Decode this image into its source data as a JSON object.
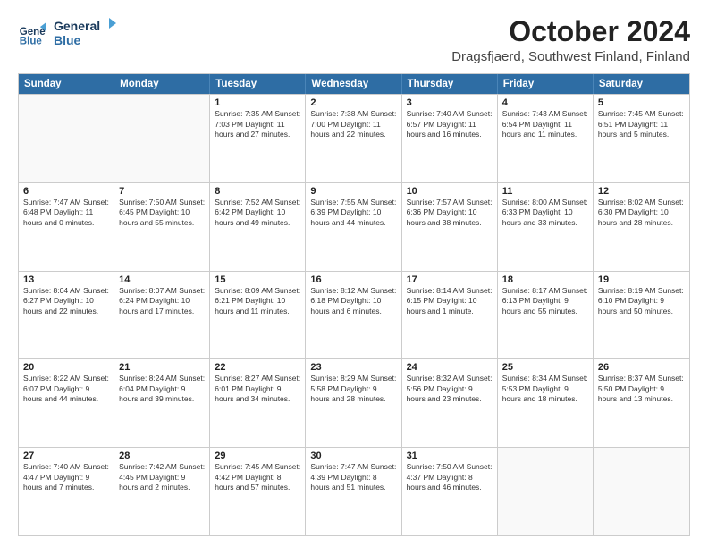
{
  "logo": {
    "line1": "General",
    "line2": "Blue"
  },
  "title": "October 2024",
  "location": "Dragsfjaerd, Southwest Finland, Finland",
  "headers": [
    "Sunday",
    "Monday",
    "Tuesday",
    "Wednesday",
    "Thursday",
    "Friday",
    "Saturday"
  ],
  "weeks": [
    [
      {
        "day": "",
        "info": ""
      },
      {
        "day": "",
        "info": ""
      },
      {
        "day": "1",
        "info": "Sunrise: 7:35 AM\nSunset: 7:03 PM\nDaylight: 11 hours\nand 27 minutes."
      },
      {
        "day": "2",
        "info": "Sunrise: 7:38 AM\nSunset: 7:00 PM\nDaylight: 11 hours\nand 22 minutes."
      },
      {
        "day": "3",
        "info": "Sunrise: 7:40 AM\nSunset: 6:57 PM\nDaylight: 11 hours\nand 16 minutes."
      },
      {
        "day": "4",
        "info": "Sunrise: 7:43 AM\nSunset: 6:54 PM\nDaylight: 11 hours\nand 11 minutes."
      },
      {
        "day": "5",
        "info": "Sunrise: 7:45 AM\nSunset: 6:51 PM\nDaylight: 11 hours\nand 5 minutes."
      }
    ],
    [
      {
        "day": "6",
        "info": "Sunrise: 7:47 AM\nSunset: 6:48 PM\nDaylight: 11 hours\nand 0 minutes."
      },
      {
        "day": "7",
        "info": "Sunrise: 7:50 AM\nSunset: 6:45 PM\nDaylight: 10 hours\nand 55 minutes."
      },
      {
        "day": "8",
        "info": "Sunrise: 7:52 AM\nSunset: 6:42 PM\nDaylight: 10 hours\nand 49 minutes."
      },
      {
        "day": "9",
        "info": "Sunrise: 7:55 AM\nSunset: 6:39 PM\nDaylight: 10 hours\nand 44 minutes."
      },
      {
        "day": "10",
        "info": "Sunrise: 7:57 AM\nSunset: 6:36 PM\nDaylight: 10 hours\nand 38 minutes."
      },
      {
        "day": "11",
        "info": "Sunrise: 8:00 AM\nSunset: 6:33 PM\nDaylight: 10 hours\nand 33 minutes."
      },
      {
        "day": "12",
        "info": "Sunrise: 8:02 AM\nSunset: 6:30 PM\nDaylight: 10 hours\nand 28 minutes."
      }
    ],
    [
      {
        "day": "13",
        "info": "Sunrise: 8:04 AM\nSunset: 6:27 PM\nDaylight: 10 hours\nand 22 minutes."
      },
      {
        "day": "14",
        "info": "Sunrise: 8:07 AM\nSunset: 6:24 PM\nDaylight: 10 hours\nand 17 minutes."
      },
      {
        "day": "15",
        "info": "Sunrise: 8:09 AM\nSunset: 6:21 PM\nDaylight: 10 hours\nand 11 minutes."
      },
      {
        "day": "16",
        "info": "Sunrise: 8:12 AM\nSunset: 6:18 PM\nDaylight: 10 hours\nand 6 minutes."
      },
      {
        "day": "17",
        "info": "Sunrise: 8:14 AM\nSunset: 6:15 PM\nDaylight: 10 hours\nand 1 minute."
      },
      {
        "day": "18",
        "info": "Sunrise: 8:17 AM\nSunset: 6:13 PM\nDaylight: 9 hours\nand 55 minutes."
      },
      {
        "day": "19",
        "info": "Sunrise: 8:19 AM\nSunset: 6:10 PM\nDaylight: 9 hours\nand 50 minutes."
      }
    ],
    [
      {
        "day": "20",
        "info": "Sunrise: 8:22 AM\nSunset: 6:07 PM\nDaylight: 9 hours\nand 44 minutes."
      },
      {
        "day": "21",
        "info": "Sunrise: 8:24 AM\nSunset: 6:04 PM\nDaylight: 9 hours\nand 39 minutes."
      },
      {
        "day": "22",
        "info": "Sunrise: 8:27 AM\nSunset: 6:01 PM\nDaylight: 9 hours\nand 34 minutes."
      },
      {
        "day": "23",
        "info": "Sunrise: 8:29 AM\nSunset: 5:58 PM\nDaylight: 9 hours\nand 28 minutes."
      },
      {
        "day": "24",
        "info": "Sunrise: 8:32 AM\nSunset: 5:56 PM\nDaylight: 9 hours\nand 23 minutes."
      },
      {
        "day": "25",
        "info": "Sunrise: 8:34 AM\nSunset: 5:53 PM\nDaylight: 9 hours\nand 18 minutes."
      },
      {
        "day": "26",
        "info": "Sunrise: 8:37 AM\nSunset: 5:50 PM\nDaylight: 9 hours\nand 13 minutes."
      }
    ],
    [
      {
        "day": "27",
        "info": "Sunrise: 7:40 AM\nSunset: 4:47 PM\nDaylight: 9 hours\nand 7 minutes."
      },
      {
        "day": "28",
        "info": "Sunrise: 7:42 AM\nSunset: 4:45 PM\nDaylight: 9 hours\nand 2 minutes."
      },
      {
        "day": "29",
        "info": "Sunrise: 7:45 AM\nSunset: 4:42 PM\nDaylight: 8 hours\nand 57 minutes."
      },
      {
        "day": "30",
        "info": "Sunrise: 7:47 AM\nSunset: 4:39 PM\nDaylight: 8 hours\nand 51 minutes."
      },
      {
        "day": "31",
        "info": "Sunrise: 7:50 AM\nSunset: 4:37 PM\nDaylight: 8 hours\nand 46 minutes."
      },
      {
        "day": "",
        "info": ""
      },
      {
        "day": "",
        "info": ""
      }
    ]
  ]
}
